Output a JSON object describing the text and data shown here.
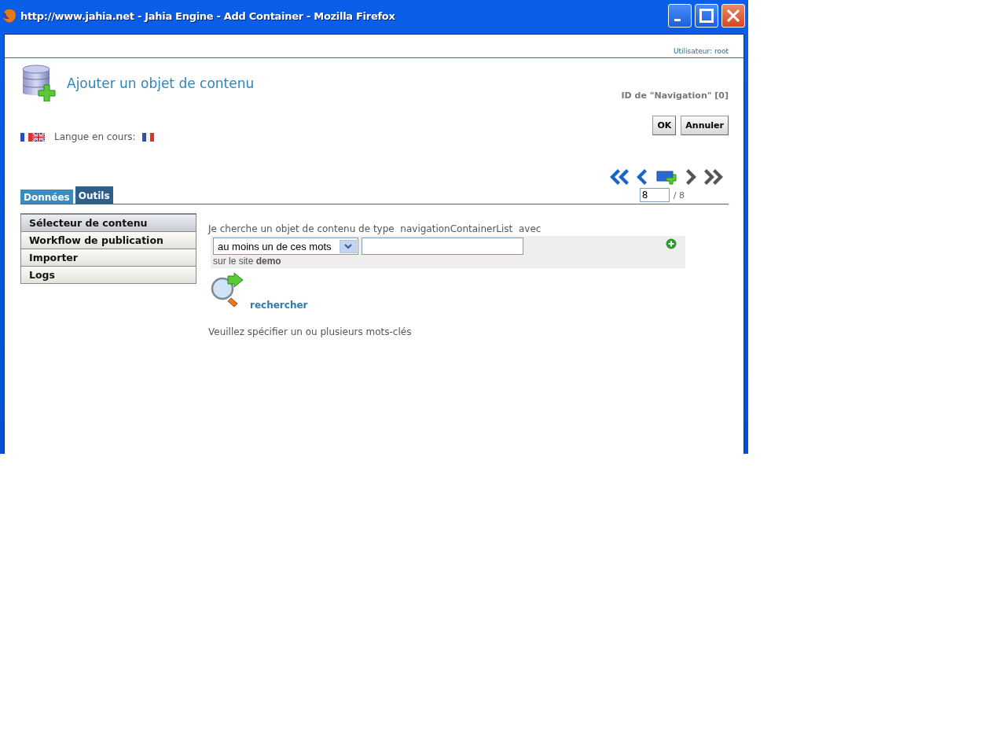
{
  "window": {
    "title": "http://www.jahia.net - Jahia Engine - Add Container - Mozilla Firefox"
  },
  "header": {
    "user": "Utilisateur: root"
  },
  "page": {
    "title": "Ajouter un objet de contenu",
    "id_label": "ID de \"Navigation\" [0]"
  },
  "buttons": [
    "OK",
    "Annuler"
  ],
  "language": {
    "label": "Langue en cours:"
  },
  "pager": {
    "current": "8",
    "total": "/ 8"
  },
  "tabs": [
    {
      "label": "Données",
      "selected": false
    },
    {
      "label": "Outils",
      "selected": true
    }
  ],
  "menu": [
    {
      "label": "Sélecteur de contenu",
      "selected": true
    },
    {
      "label": "Workflow de publication",
      "selected": false
    },
    {
      "label": "Importer",
      "selected": false
    },
    {
      "label": "Logs",
      "selected": false
    }
  ],
  "search": {
    "intro": "Je cherche un objet de contenu de type  navigationContainerList  avec",
    "mode": "au moins un de ces mots",
    "site": "sur le site **demo**",
    "action": "rechercher",
    "message": "Veuillez spécifier un ou plusieurs mots-clés"
  }
}
